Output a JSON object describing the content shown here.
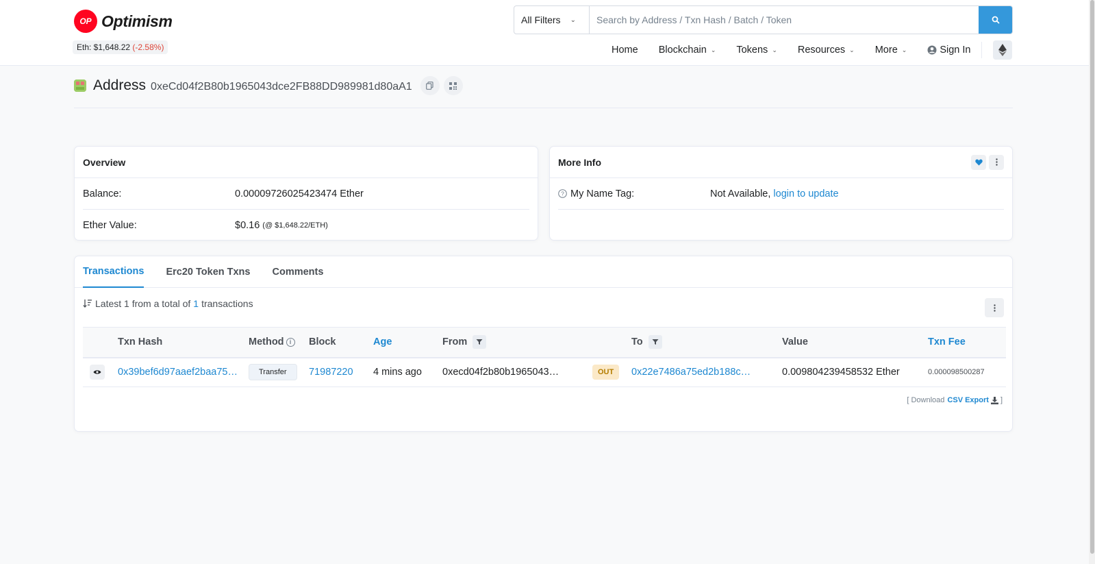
{
  "brand": {
    "logo_mark": "OP",
    "name": "Optimism"
  },
  "eth_price": {
    "label": "Eth: $1,648.22",
    "change": "(-2.58%)"
  },
  "search": {
    "filter_label": "All Filters",
    "placeholder": "Search by Address / Txn Hash / Batch / Token"
  },
  "nav": {
    "home": "Home",
    "blockchain": "Blockchain",
    "tokens": "Tokens",
    "resources": "Resources",
    "more": "More",
    "sign_in": "Sign In"
  },
  "address": {
    "title": "Address",
    "value": "0xeCd04f2B80b1965043dce2FB88DD989981d80aA1"
  },
  "overview": {
    "title": "Overview",
    "balance_label": "Balance:",
    "balance_value": "0.00009726025423474 Ether",
    "ether_value_label": "Ether Value:",
    "ether_value": "$0.16",
    "ether_value_rate": "(@ $1,648.22/ETH)"
  },
  "more_info": {
    "title": "More Info",
    "name_tag_label": "My Name Tag:",
    "name_tag_value": "Not Available,",
    "login_link": "login to update"
  },
  "tabs": [
    {
      "label": "Transactions",
      "active": true
    },
    {
      "label": "Erc20 Token Txns",
      "active": false
    },
    {
      "label": "Comments",
      "active": false
    }
  ],
  "txn_summary": {
    "prefix": "Latest 1 from a total of",
    "count": "1",
    "suffix": "transactions"
  },
  "table": {
    "headers": {
      "txn_hash": "Txn Hash",
      "method": "Method",
      "block": "Block",
      "age": "Age",
      "from": "From",
      "to": "To",
      "value": "Value",
      "txn_fee": "Txn Fee"
    },
    "rows": [
      {
        "txn_hash": "0x39bef6d97aaef2baa75…",
        "method": "Transfer",
        "block": "71987220",
        "age": "4 mins ago",
        "from": "0xecd04f2b80b1965043…",
        "direction": "OUT",
        "to": "0x22e7486a75ed2b188c…",
        "value": "0.009804239458532 Ether",
        "txn_fee": "0.000098500287"
      }
    ]
  },
  "csv": {
    "prefix": "[ Download",
    "link": "CSV Export",
    "suffix": "]"
  },
  "colors": {
    "accent": "#1e88d1",
    "brand_red": "#ff0420",
    "search_button": "#3498db",
    "negative": "#de4437",
    "out_badge_bg": "#fbe9c8"
  }
}
